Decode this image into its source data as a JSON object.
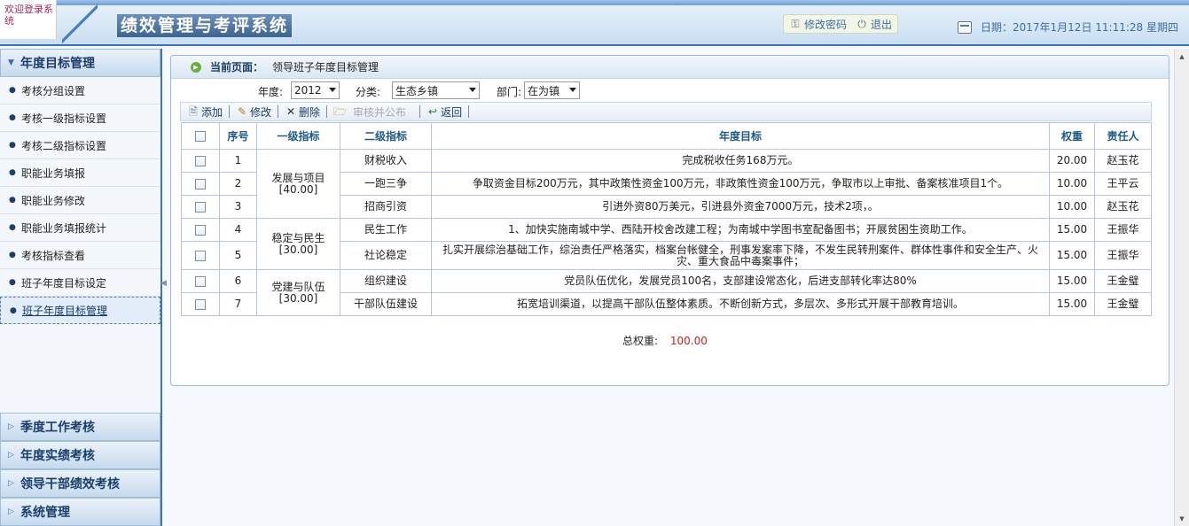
{
  "header": {
    "welcome": "欢迎登录系统",
    "title": "绩效管理与考评系统",
    "change_password": "修改密码",
    "logout": "退出",
    "date_text": "日期：2017年1月12日 11:11:28 星期四"
  },
  "sidebar": {
    "section_title": "年度目标管理",
    "items": [
      {
        "label": "考核分组设置"
      },
      {
        "label": "考核一级指标设置"
      },
      {
        "label": "考核二级指标设置"
      },
      {
        "label": "职能业务填报"
      },
      {
        "label": "职能业务修改"
      },
      {
        "label": "职能业务填报统计"
      },
      {
        "label": "考核指标查看"
      },
      {
        "label": "班子年度目标设定"
      },
      {
        "label": "班子年度目标管理"
      }
    ],
    "bottom_sections": [
      {
        "label": "季度工作考核"
      },
      {
        "label": "年度实绩考核"
      },
      {
        "label": "领导干部绩效考核"
      },
      {
        "label": "系统管理"
      }
    ]
  },
  "breadcrumb": {
    "label": "当前页面：",
    "value": "领导班子年度目标管理"
  },
  "filters": {
    "year_label": "年度:",
    "year_value": "2012",
    "category_label": "分类:",
    "category_value": "生态乡镇",
    "dept_label": "部门:",
    "dept_value": "在为镇"
  },
  "toolbar": {
    "add": "添加",
    "edit": "修改",
    "delete": "删除",
    "audit_publish": "审核并公布",
    "back": "返回"
  },
  "table": {
    "headers": {
      "seq": "序号",
      "level1": "一级指标",
      "level2": "二级指标",
      "goal": "年度目标",
      "weight": "权重",
      "owner": "责任人"
    },
    "groups": [
      {
        "name": "发展与项目",
        "weight": "[40.00]"
      },
      {
        "name": "稳定与民生",
        "weight": "[30.00]"
      },
      {
        "name": "党建与队伍",
        "weight": "[30.00]"
      }
    ],
    "rows": [
      {
        "seq": "1",
        "level2": "财税收入",
        "goal": "完成税收任务168万元。",
        "weight": "20.00",
        "owner": "赵玉花"
      },
      {
        "seq": "2",
        "level2": "一跑三争",
        "goal": "争取资金目标200万元，其中政策性资金100万元，非政策性资金100万元，争取市以上审批、备案核准项目1个。",
        "weight": "10.00",
        "owner": "王平云"
      },
      {
        "seq": "3",
        "level2": "招商引资",
        "goal": "引进外资80万美元，引进县外资金7000万元，技术2项，。",
        "weight": "10.00",
        "owner": "赵玉花"
      },
      {
        "seq": "4",
        "level2": "民生工作",
        "goal": "1、加快实施南城中学、西陆开校舍改建工程；为南城中学图书室配备图书；开展贫困生资助工作。",
        "weight": "15.00",
        "owner": "王振华"
      },
      {
        "seq": "5",
        "level2": "社论稳定",
        "goal": "扎实开展综治基础工作，综治责任严格落实，档案台帐健全，刑事发案率下降，不发生民转刑案件、群体性事件和安全生产、火灾、重大食品中毒案事件；",
        "weight": "15.00",
        "owner": "王振华"
      },
      {
        "seq": "6",
        "level2": "组织建设",
        "goal": "党员队伍优化，发展党员100名，支部建设常态化，后进支部转化率达80%",
        "weight": "15.00",
        "owner": "王金璧"
      },
      {
        "seq": "7",
        "level2": "干部队伍建设",
        "goal": "拓宽培训渠道，以提高干部队伍整体素质。不断创新方式，多层次、多形式开展干部教育培训。",
        "weight": "15.00",
        "owner": "王金璧"
      }
    ]
  },
  "total": {
    "label": "总权重:",
    "value": "100.00"
  },
  "colors": {
    "accent": "#3f76b2",
    "header_text": "#1c5b86",
    "total_value": "#c02222"
  }
}
